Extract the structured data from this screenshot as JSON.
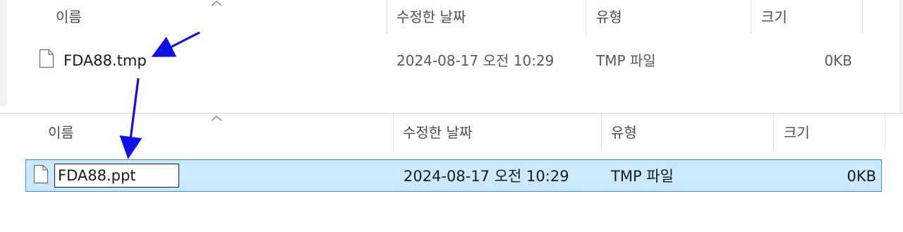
{
  "top_panel": {
    "headers": {
      "name": "이름",
      "modified": "수정한 날짜",
      "type": "유형",
      "size": "크기"
    },
    "file": {
      "name": "FDA88.tmp",
      "modified": "2024-08-17 오전 10:29",
      "type": "TMP 파일",
      "size": "0KB"
    }
  },
  "bottom_panel": {
    "headers": {
      "name": "이름",
      "modified": "수정한 날짜",
      "type": "유형",
      "size": "크기"
    },
    "file": {
      "name_edit_value": "FDA88.ppt",
      "modified": "2024-08-17 오전 10:29",
      "type": "TMP 파일",
      "size": "0KB"
    }
  },
  "colors": {
    "selection_bg": "#cce8ff",
    "selection_border": "#3d8ce8",
    "annotation_arrow": "#1010e0"
  }
}
